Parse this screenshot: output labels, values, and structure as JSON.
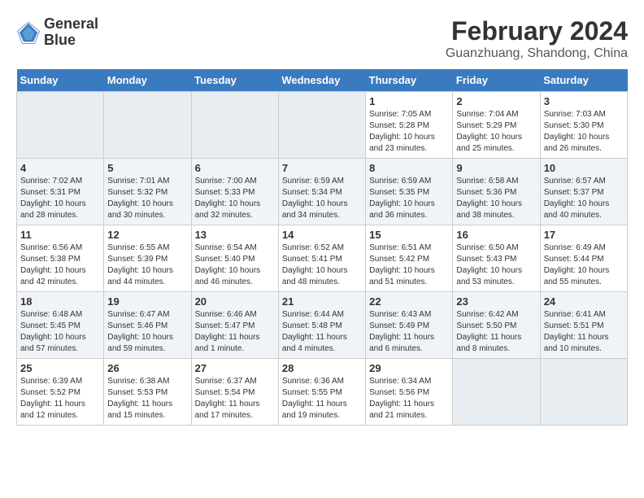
{
  "logo": {
    "line1": "General",
    "line2": "Blue"
  },
  "title": "February 2024",
  "location": "Guanzhuang, Shandong, China",
  "weekdays": [
    "Sunday",
    "Monday",
    "Tuesday",
    "Wednesday",
    "Thursday",
    "Friday",
    "Saturday"
  ],
  "weeks": [
    [
      {
        "day": "",
        "sunrise": "",
        "sunset": "",
        "daylight": "",
        "empty": true
      },
      {
        "day": "",
        "sunrise": "",
        "sunset": "",
        "daylight": "",
        "empty": true
      },
      {
        "day": "",
        "sunrise": "",
        "sunset": "",
        "daylight": "",
        "empty": true
      },
      {
        "day": "",
        "sunrise": "",
        "sunset": "",
        "daylight": "",
        "empty": true
      },
      {
        "day": "1",
        "sunrise": "Sunrise: 7:05 AM",
        "sunset": "Sunset: 5:28 PM",
        "daylight": "Daylight: 10 hours and 23 minutes."
      },
      {
        "day": "2",
        "sunrise": "Sunrise: 7:04 AM",
        "sunset": "Sunset: 5:29 PM",
        "daylight": "Daylight: 10 hours and 25 minutes."
      },
      {
        "day": "3",
        "sunrise": "Sunrise: 7:03 AM",
        "sunset": "Sunset: 5:30 PM",
        "daylight": "Daylight: 10 hours and 26 minutes."
      }
    ],
    [
      {
        "day": "4",
        "sunrise": "Sunrise: 7:02 AM",
        "sunset": "Sunset: 5:31 PM",
        "daylight": "Daylight: 10 hours and 28 minutes."
      },
      {
        "day": "5",
        "sunrise": "Sunrise: 7:01 AM",
        "sunset": "Sunset: 5:32 PM",
        "daylight": "Daylight: 10 hours and 30 minutes."
      },
      {
        "day": "6",
        "sunrise": "Sunrise: 7:00 AM",
        "sunset": "Sunset: 5:33 PM",
        "daylight": "Daylight: 10 hours and 32 minutes."
      },
      {
        "day": "7",
        "sunrise": "Sunrise: 6:59 AM",
        "sunset": "Sunset: 5:34 PM",
        "daylight": "Daylight: 10 hours and 34 minutes."
      },
      {
        "day": "8",
        "sunrise": "Sunrise: 6:59 AM",
        "sunset": "Sunset: 5:35 PM",
        "daylight": "Daylight: 10 hours and 36 minutes."
      },
      {
        "day": "9",
        "sunrise": "Sunrise: 6:58 AM",
        "sunset": "Sunset: 5:36 PM",
        "daylight": "Daylight: 10 hours and 38 minutes."
      },
      {
        "day": "10",
        "sunrise": "Sunrise: 6:57 AM",
        "sunset": "Sunset: 5:37 PM",
        "daylight": "Daylight: 10 hours and 40 minutes."
      }
    ],
    [
      {
        "day": "11",
        "sunrise": "Sunrise: 6:56 AM",
        "sunset": "Sunset: 5:38 PM",
        "daylight": "Daylight: 10 hours and 42 minutes."
      },
      {
        "day": "12",
        "sunrise": "Sunrise: 6:55 AM",
        "sunset": "Sunset: 5:39 PM",
        "daylight": "Daylight: 10 hours and 44 minutes."
      },
      {
        "day": "13",
        "sunrise": "Sunrise: 6:54 AM",
        "sunset": "Sunset: 5:40 PM",
        "daylight": "Daylight: 10 hours and 46 minutes."
      },
      {
        "day": "14",
        "sunrise": "Sunrise: 6:52 AM",
        "sunset": "Sunset: 5:41 PM",
        "daylight": "Daylight: 10 hours and 48 minutes."
      },
      {
        "day": "15",
        "sunrise": "Sunrise: 6:51 AM",
        "sunset": "Sunset: 5:42 PM",
        "daylight": "Daylight: 10 hours and 51 minutes."
      },
      {
        "day": "16",
        "sunrise": "Sunrise: 6:50 AM",
        "sunset": "Sunset: 5:43 PM",
        "daylight": "Daylight: 10 hours and 53 minutes."
      },
      {
        "day": "17",
        "sunrise": "Sunrise: 6:49 AM",
        "sunset": "Sunset: 5:44 PM",
        "daylight": "Daylight: 10 hours and 55 minutes."
      }
    ],
    [
      {
        "day": "18",
        "sunrise": "Sunrise: 6:48 AM",
        "sunset": "Sunset: 5:45 PM",
        "daylight": "Daylight: 10 hours and 57 minutes."
      },
      {
        "day": "19",
        "sunrise": "Sunrise: 6:47 AM",
        "sunset": "Sunset: 5:46 PM",
        "daylight": "Daylight: 10 hours and 59 minutes."
      },
      {
        "day": "20",
        "sunrise": "Sunrise: 6:46 AM",
        "sunset": "Sunset: 5:47 PM",
        "daylight": "Daylight: 11 hours and 1 minute."
      },
      {
        "day": "21",
        "sunrise": "Sunrise: 6:44 AM",
        "sunset": "Sunset: 5:48 PM",
        "daylight": "Daylight: 11 hours and 4 minutes."
      },
      {
        "day": "22",
        "sunrise": "Sunrise: 6:43 AM",
        "sunset": "Sunset: 5:49 PM",
        "daylight": "Daylight: 11 hours and 6 minutes."
      },
      {
        "day": "23",
        "sunrise": "Sunrise: 6:42 AM",
        "sunset": "Sunset: 5:50 PM",
        "daylight": "Daylight: 11 hours and 8 minutes."
      },
      {
        "day": "24",
        "sunrise": "Sunrise: 6:41 AM",
        "sunset": "Sunset: 5:51 PM",
        "daylight": "Daylight: 11 hours and 10 minutes."
      }
    ],
    [
      {
        "day": "25",
        "sunrise": "Sunrise: 6:39 AM",
        "sunset": "Sunset: 5:52 PM",
        "daylight": "Daylight: 11 hours and 12 minutes."
      },
      {
        "day": "26",
        "sunrise": "Sunrise: 6:38 AM",
        "sunset": "Sunset: 5:53 PM",
        "daylight": "Daylight: 11 hours and 15 minutes."
      },
      {
        "day": "27",
        "sunrise": "Sunrise: 6:37 AM",
        "sunset": "Sunset: 5:54 PM",
        "daylight": "Daylight: 11 hours and 17 minutes."
      },
      {
        "day": "28",
        "sunrise": "Sunrise: 6:36 AM",
        "sunset": "Sunset: 5:55 PM",
        "daylight": "Daylight: 11 hours and 19 minutes."
      },
      {
        "day": "29",
        "sunrise": "Sunrise: 6:34 AM",
        "sunset": "Sunset: 5:56 PM",
        "daylight": "Daylight: 11 hours and 21 minutes."
      },
      {
        "day": "",
        "sunrise": "",
        "sunset": "",
        "daylight": "",
        "empty": true
      },
      {
        "day": "",
        "sunrise": "",
        "sunset": "",
        "daylight": "",
        "empty": true
      }
    ]
  ]
}
